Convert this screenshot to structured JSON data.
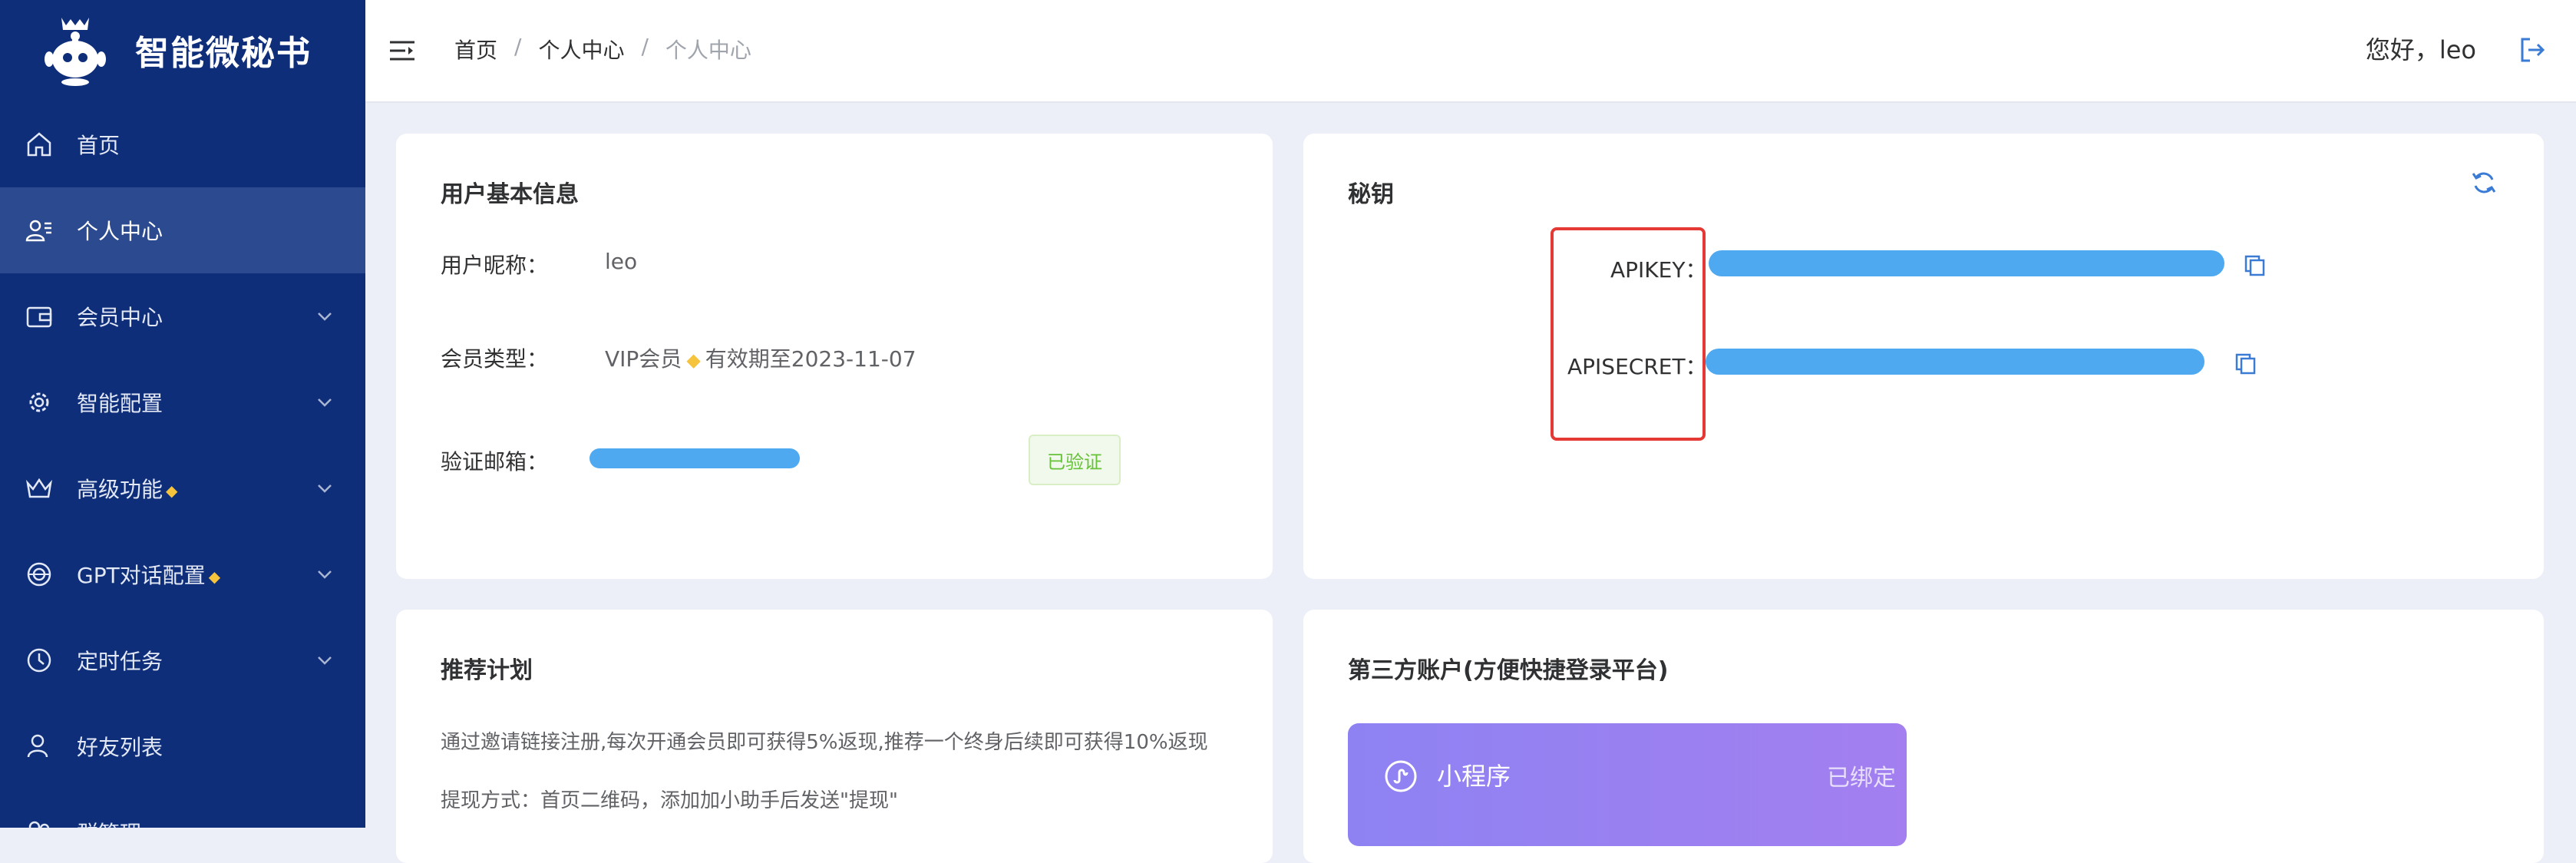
{
  "app": {
    "title": "智能微秘书"
  },
  "sidebar": {
    "items": [
      {
        "label": "首页",
        "icon": "home-icon"
      },
      {
        "label": "个人中心",
        "icon": "user-card-icon",
        "active": true
      },
      {
        "label": "会员中心",
        "icon": "wallet-icon"
      },
      {
        "label": "智能配置",
        "icon": "gear-icon"
      },
      {
        "label": "高级功能",
        "icon": "crown-icon"
      },
      {
        "label": "GPT对话配置",
        "icon": "chat-ai-icon"
      },
      {
        "label": "定时任务",
        "icon": "clock-icon"
      },
      {
        "label": "好友列表",
        "icon": "friend-icon"
      },
      {
        "label": "群管理",
        "icon": "group-icon"
      }
    ]
  },
  "header": {
    "breadcrumb": [
      "首页",
      "个人中心",
      "个人中心"
    ],
    "greeting": "您好，leo"
  },
  "user_info": {
    "title": "用户基本信息",
    "nickname_label": "用户昵称：",
    "nickname_value": "leo",
    "member_type_label": "会员类型：",
    "member_type_value": "VIP会员",
    "expiry_text": "有效期至2023-11-07",
    "email_label": "验证邮箱：",
    "verified_tag": "已验证"
  },
  "secret": {
    "title": "秘钥",
    "apikey_label": "APIKEY：",
    "apisecret_label": "APISECRET："
  },
  "recommend": {
    "title": "推荐计划",
    "line1": "通过邀请链接注册,每次开通会员即可获得5%返现,推荐一个终身后续即可获得10%返现",
    "line2": "提现方式：首页二维码，添加加小助手后发送\"提现\""
  },
  "third_party": {
    "title": "第三方账户(方便快捷登录平台)",
    "accounts": [
      {
        "name": "小程序",
        "status": "已绑定"
      }
    ]
  },
  "colors": {
    "sidebar_bg": "#0f2e7a",
    "sidebar_active": "#2c4a8f",
    "accent_blue": "#3a7bd5",
    "verified_green": "#67c23a",
    "highlight_red": "#e53935",
    "mini_gradient_start": "#8e82f2",
    "mini_gradient_end": "#a37ff0"
  }
}
